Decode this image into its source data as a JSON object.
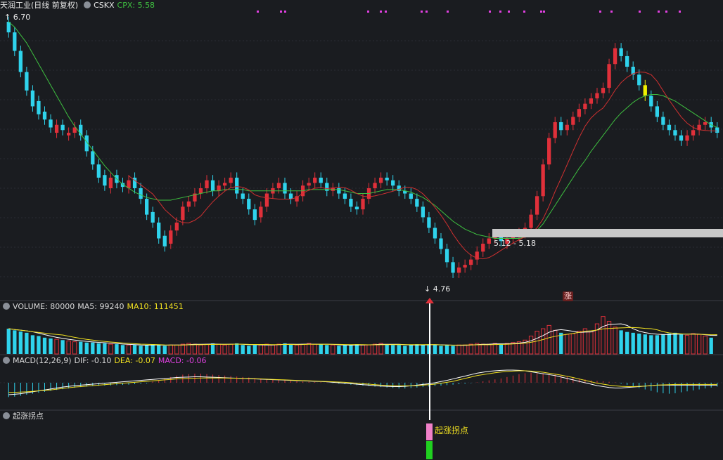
{
  "header": {
    "title": "天润工业(日线 前复权)",
    "code": "CSKX",
    "cpx_label": "CPX: 5.58"
  },
  "volume_header": {
    "label": "VOLUME: 80000",
    "ma5": "MA5: 99240",
    "ma10": "MA10: 111451"
  },
  "macd_header": {
    "label": "MACD(12,26,9)",
    "dif": "DIF: -0.10",
    "dea": "DEA: -0.07",
    "macd": "MACD: -0.06"
  },
  "signal_header": {
    "label": "起涨拐点"
  },
  "annotations": {
    "high_price": "6.70",
    "low_price": "4.76",
    "zone_label": "5.12 - 5.18",
    "zhang": "涨",
    "signal_text": "起涨拐点"
  },
  "colors": {
    "background": "#1a1c20",
    "up": "#e0303a",
    "down": "#2fd3ec",
    "ma_green": "#3ec040",
    "ma_red": "#d03030",
    "yellow": "#f0f000",
    "magenta": "#e040e0",
    "pink": "#f080c8",
    "signal_green": "#20d020",
    "zone_gray": "#c8c8c8"
  },
  "chart_data": {
    "type": "candlestick",
    "ylim": [
      4.6,
      6.78
    ],
    "high": 6.7,
    "low": 4.76,
    "zone": [
      5.12,
      5.18
    ],
    "signal_index": 106,
    "close": [
      6.62,
      6.48,
      6.32,
      6.18,
      6.06,
      6.0,
      5.96,
      5.9,
      5.92,
      5.88,
      5.86,
      5.9,
      5.84,
      5.72,
      5.62,
      5.52,
      5.46,
      5.52,
      5.48,
      5.45,
      5.5,
      5.44,
      5.36,
      5.24,
      5.18,
      5.06,
      5.0,
      5.12,
      5.18,
      5.3,
      5.34,
      5.4,
      5.44,
      5.5,
      5.42,
      5.46,
      5.48,
      5.52,
      5.4,
      5.36,
      5.28,
      5.2,
      5.3,
      5.4,
      5.44,
      5.48,
      5.4,
      5.36,
      5.38,
      5.46,
      5.48,
      5.52,
      5.48,
      5.42,
      5.44,
      5.4,
      5.36,
      5.3,
      5.28,
      5.36,
      5.44,
      5.48,
      5.52,
      5.5,
      5.46,
      5.42,
      5.4,
      5.36,
      5.3,
      5.22,
      5.14,
      5.06,
      4.98,
      4.88,
      4.8,
      4.84,
      4.86,
      4.9,
      4.96,
      5.02,
      5.06,
      5.08,
      5.04,
      5.06,
      5.08,
      5.1,
      5.14,
      5.24,
      5.38,
      5.62,
      5.82,
      5.94,
      5.88,
      5.92,
      5.98,
      6.04,
      6.08,
      6.12,
      6.16,
      6.2,
      6.38,
      6.5,
      6.44,
      6.36,
      6.3,
      6.22,
      6.14,
      6.06,
      5.98,
      5.92,
      5.88,
      5.84,
      5.8,
      5.84,
      5.88,
      5.92,
      5.94,
      5.9,
      5.86
    ],
    "open": [
      6.7,
      6.62,
      6.48,
      6.32,
      6.18,
      6.1,
      6.02,
      5.96,
      5.86,
      5.92,
      5.84,
      5.86,
      5.92,
      5.84,
      5.72,
      5.62,
      5.54,
      5.44,
      5.54,
      5.48,
      5.44,
      5.52,
      5.44,
      5.36,
      5.26,
      5.18,
      5.08,
      5.02,
      5.12,
      5.2,
      5.3,
      5.34,
      5.4,
      5.44,
      5.5,
      5.42,
      5.46,
      5.48,
      5.52,
      5.4,
      5.36,
      5.28,
      5.22,
      5.3,
      5.4,
      5.44,
      5.48,
      5.4,
      5.34,
      5.38,
      5.46,
      5.48,
      5.52,
      5.48,
      5.42,
      5.44,
      5.4,
      5.36,
      5.3,
      5.28,
      5.36,
      5.44,
      5.48,
      5.52,
      5.5,
      5.46,
      5.42,
      5.4,
      5.36,
      5.3,
      5.22,
      5.14,
      5.06,
      4.98,
      4.88,
      4.8,
      4.84,
      4.86,
      4.9,
      4.96,
      5.02,
      5.06,
      5.08,
      5.02,
      5.06,
      5.08,
      5.1,
      5.14,
      5.24,
      5.38,
      5.62,
      5.82,
      5.94,
      5.88,
      5.92,
      5.98,
      6.04,
      6.08,
      6.12,
      6.16,
      6.2,
      6.38,
      6.5,
      6.44,
      6.36,
      6.3,
      6.22,
      6.14,
      6.06,
      5.98,
      5.92,
      5.88,
      5.84,
      5.8,
      5.84,
      5.88,
      5.92,
      5.94,
      5.9
    ],
    "ma_green": [
      6.7,
      6.66,
      6.6,
      6.54,
      6.46,
      6.38,
      6.3,
      6.22,
      6.14,
      6.06,
      5.98,
      5.91,
      5.85,
      5.79,
      5.73,
      5.67,
      5.61,
      5.56,
      5.51,
      5.47,
      5.44,
      5.41,
      5.39,
      5.37,
      5.36,
      5.35,
      5.35,
      5.35,
      5.36,
      5.37,
      5.38,
      5.39,
      5.4,
      5.41,
      5.42,
      5.42,
      5.43,
      5.43,
      5.43,
      5.43,
      5.42,
      5.42,
      5.42,
      5.42,
      5.42,
      5.42,
      5.42,
      5.42,
      5.42,
      5.42,
      5.43,
      5.43,
      5.43,
      5.43,
      5.43,
      5.43,
      5.42,
      5.41,
      5.4,
      5.4,
      5.4,
      5.41,
      5.42,
      5.43,
      5.43,
      5.43,
      5.42,
      5.41,
      5.39,
      5.37,
      5.34,
      5.31,
      5.27,
      5.23,
      5.19,
      5.16,
      5.13,
      5.11,
      5.09,
      5.08,
      5.07,
      5.06,
      5.06,
      5.06,
      5.06,
      5.06,
      5.07,
      5.09,
      5.12,
      5.17,
      5.24,
      5.31,
      5.38,
      5.45,
      5.52,
      5.59,
      5.65,
      5.72,
      5.78,
      5.84,
      5.9,
      5.96,
      6.01,
      6.05,
      6.09,
      6.12,
      6.14,
      6.15,
      6.15,
      6.14,
      6.12,
      6.1,
      6.07,
      6.04,
      6.01,
      5.98,
      5.95,
      5.92,
      5.9
    ],
    "volume": [
      0.62,
      0.58,
      0.55,
      0.52,
      0.46,
      0.44,
      0.4,
      0.38,
      0.36,
      0.34,
      0.32,
      0.3,
      0.3,
      0.28,
      0.28,
      0.26,
      0.26,
      0.24,
      0.24,
      0.22,
      0.22,
      0.22,
      0.2,
      0.22,
      0.24,
      0.22,
      0.2,
      0.22,
      0.22,
      0.24,
      0.26,
      0.24,
      0.22,
      0.24,
      0.26,
      0.24,
      0.22,
      0.24,
      0.26,
      0.22,
      0.2,
      0.22,
      0.22,
      0.24,
      0.22,
      0.24,
      0.26,
      0.24,
      0.22,
      0.24,
      0.26,
      0.24,
      0.24,
      0.22,
      0.22,
      0.2,
      0.22,
      0.22,
      0.24,
      0.22,
      0.22,
      0.24,
      0.26,
      0.24,
      0.22,
      0.22,
      0.2,
      0.22,
      0.24,
      0.22,
      0.24,
      0.22,
      0.2,
      0.22,
      0.2,
      0.22,
      0.22,
      0.24,
      0.26,
      0.24,
      0.24,
      0.26,
      0.24,
      0.26,
      0.28,
      0.3,
      0.34,
      0.44,
      0.56,
      0.62,
      0.7,
      0.58,
      0.52,
      0.48,
      0.5,
      0.56,
      0.62,
      0.54,
      0.74,
      0.92,
      0.8,
      0.66,
      0.58,
      0.54,
      0.52,
      0.5,
      0.48,
      0.46,
      0.46,
      0.48,
      0.5,
      0.52,
      0.48,
      0.46,
      0.5,
      0.48,
      0.44,
      0.4
    ],
    "macd_hist": [
      -0.6,
      -0.58,
      -0.55,
      -0.5,
      -0.46,
      -0.42,
      -0.38,
      -0.34,
      -0.3,
      -0.27,
      -0.24,
      -0.21,
      -0.18,
      -0.16,
      -0.14,
      -0.13,
      -0.12,
      -0.11,
      -0.1,
      -0.09,
      -0.08,
      -0.06,
      -0.04,
      -0.03,
      0.05,
      0.1,
      0.16,
      0.24,
      0.3,
      0.34,
      0.36,
      0.38,
      0.38,
      0.36,
      0.34,
      0.32,
      0.3,
      0.28,
      0.26,
      0.24,
      0.22,
      0.2,
      0.18,
      0.16,
      0.14,
      0.12,
      0.1,
      0.08,
      0.06,
      0.05,
      0.04,
      0.03,
      0.02,
      0.01,
      -0.02,
      -0.04,
      -0.06,
      -0.08,
      -0.1,
      -0.12,
      -0.14,
      -0.16,
      -0.18,
      -0.2,
      -0.22,
      -0.24,
      -0.24,
      -0.22,
      -0.2,
      -0.18,
      -0.16,
      -0.14,
      -0.12,
      -0.1,
      -0.08,
      -0.06,
      -0.04,
      -0.02,
      0.02,
      0.06,
      0.1,
      0.14,
      0.18,
      0.24,
      0.3,
      0.36,
      0.4,
      0.42,
      0.4,
      0.38,
      0.36,
      0.34,
      0.3,
      0.26,
      0.22,
      0.18,
      0.14,
      0.1,
      0.08,
      0.06,
      0.04,
      0.02,
      -0.04,
      -0.1,
      -0.16,
      -0.22,
      -0.28,
      -0.34,
      -0.4,
      -0.44,
      -0.46,
      -0.44,
      -0.4,
      -0.36,
      -0.32,
      -0.28,
      -0.24,
      -0.2,
      -0.16
    ],
    "dif": [
      -0.5,
      -0.48,
      -0.46,
      -0.42,
      -0.38,
      -0.34,
      -0.3,
      -0.26,
      -0.22,
      -0.18,
      -0.15,
      -0.12,
      -0.1,
      -0.08,
      -0.06,
      -0.04,
      -0.02,
      0.0,
      0.02,
      0.04,
      0.06,
      0.08,
      0.1,
      0.12,
      0.14,
      0.16,
      0.18,
      0.2,
      0.22,
      0.23,
      0.24,
      0.25,
      0.25,
      0.24,
      0.23,
      0.22,
      0.21,
      0.2,
      0.19,
      0.18,
      0.17,
      0.16,
      0.15,
      0.14,
      0.13,
      0.12,
      0.11,
      0.1,
      0.09,
      0.08,
      0.07,
      0.06,
      0.05,
      0.04,
      0.02,
      0.0,
      -0.02,
      -0.04,
      -0.06,
      -0.08,
      -0.1,
      -0.12,
      -0.14,
      -0.15,
      -0.16,
      -0.16,
      -0.15,
      -0.13,
      -0.1,
      -0.07,
      -0.04,
      0.0,
      0.05,
      0.1,
      0.16,
      0.22,
      0.28,
      0.34,
      0.4,
      0.44,
      0.48,
      0.5,
      0.52,
      0.53,
      0.53,
      0.52,
      0.5,
      0.46,
      0.42,
      0.38,
      0.34,
      0.3,
      0.24,
      0.18,
      0.12,
      0.06,
      0.0,
      -0.06,
      -0.12,
      -0.16,
      -0.2,
      -0.22,
      -0.22,
      -0.2,
      -0.18,
      -0.16,
      -0.14,
      -0.12,
      -0.1,
      -0.1,
      -0.1,
      -0.1,
      -0.1,
      -0.1,
      -0.1,
      -0.1,
      -0.1,
      -0.1,
      -0.1
    ],
    "dea": [
      -0.4,
      -0.4,
      -0.39,
      -0.38,
      -0.36,
      -0.34,
      -0.32,
      -0.3,
      -0.27,
      -0.24,
      -0.21,
      -0.18,
      -0.16,
      -0.14,
      -0.12,
      -0.1,
      -0.08,
      -0.06,
      -0.04,
      -0.02,
      0.0,
      0.02,
      0.04,
      0.06,
      0.08,
      0.1,
      0.12,
      0.14,
      0.16,
      0.17,
      0.18,
      0.19,
      0.2,
      0.2,
      0.2,
      0.2,
      0.2,
      0.19,
      0.19,
      0.18,
      0.18,
      0.17,
      0.16,
      0.15,
      0.14,
      0.13,
      0.12,
      0.11,
      0.1,
      0.09,
      0.08,
      0.07,
      0.06,
      0.05,
      0.04,
      0.03,
      0.02,
      0.0,
      -0.02,
      -0.04,
      -0.06,
      -0.08,
      -0.1,
      -0.11,
      -0.12,
      -0.13,
      -0.13,
      -0.13,
      -0.12,
      -0.1,
      -0.08,
      -0.06,
      -0.02,
      0.02,
      0.06,
      0.12,
      0.18,
      0.24,
      0.3,
      0.34,
      0.38,
      0.42,
      0.45,
      0.47,
      0.49,
      0.5,
      0.5,
      0.49,
      0.47,
      0.44,
      0.4,
      0.36,
      0.32,
      0.27,
      0.22,
      0.16,
      0.1,
      0.04,
      -0.02,
      -0.06,
      -0.1,
      -0.13,
      -0.15,
      -0.16,
      -0.16,
      -0.15,
      -0.14,
      -0.12,
      -0.1,
      -0.09,
      -0.08,
      -0.07,
      -0.07,
      -0.07,
      -0.07,
      -0.07,
      -0.07,
      -0.07,
      -0.07
    ]
  }
}
